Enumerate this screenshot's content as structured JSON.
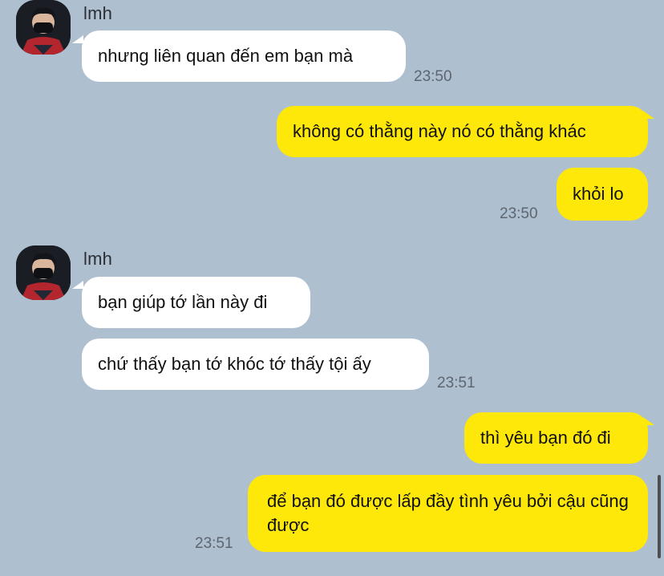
{
  "messages": [
    {
      "sender": "lmh",
      "text": "nhưng liên quan đến em bạn mà",
      "time": "23:50"
    },
    {
      "text": "không có thằng này nó có thằng khác"
    },
    {
      "text": "khỏi lo",
      "time": "23:50"
    },
    {
      "sender": "lmh",
      "text": "bạn giúp tớ lần này đi"
    },
    {
      "text": "chứ thấy bạn tớ khóc tớ thấy tội ấy",
      "time": "23:51"
    },
    {
      "text": "thì yêu bạn đó đi"
    },
    {
      "text": "để bạn đó được lấp đầy tình yêu bởi cậu cũng được",
      "time": "23:51"
    }
  ],
  "colors": {
    "background": "#aebfcf",
    "incoming": "#ffffff",
    "outgoing": "#fde809"
  },
  "icons": {
    "avatar": "user-avatar-photo"
  }
}
